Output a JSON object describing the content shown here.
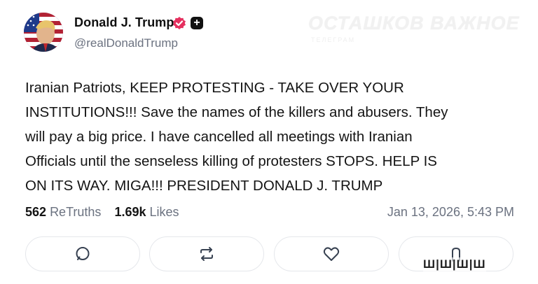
{
  "author": {
    "name": "Donald J. Trump",
    "handle": "@realDonaldTrump",
    "verified_icon": "verified-badge-icon",
    "plus_icon": "plus-badge-icon",
    "verified_color": "#e5305f"
  },
  "watermark": {
    "text": "ОСТАШКОВ ВАЖНОЕ",
    "subtext": "ТЕЛЕГРАМ"
  },
  "post": {
    "text": "Iranian Patriots, KEEP PROTESTING - TAKE OVER YOUR\nINSTITUTIONS!!! Save the names of the killers and abusers. They\nwill pay a big price. I have cancelled all meetings with Iranian\nOfficials until the senseless killing of protesters STOPS. HELP IS\nON ITS WAY. MIGA!!! PRESIDENT DONALD J. TRUMP"
  },
  "stats": {
    "retruths_count": "562",
    "retruths_label": "ReTruths",
    "likes_count": "1.69k",
    "likes_label": "Likes",
    "timestamp": "Jan 13, 2026, 5:43 PM"
  },
  "actions": {
    "reply_icon": "reply-bubble-icon",
    "retruth_icon": "retruth-arrows-icon",
    "like_icon": "heart-icon",
    "share_icon": "share-icon"
  },
  "corner_watermark": "Ш|Ш|Ш|Ш"
}
